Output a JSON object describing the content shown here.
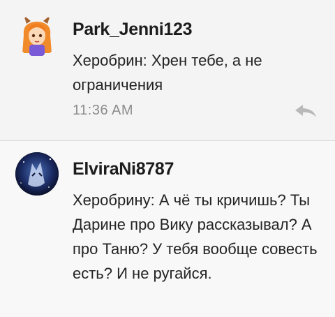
{
  "comments": [
    {
      "username": "Park_Jenni123",
      "text": "Херобрин: Хрен тебе, а не ограничения",
      "time": "11:36 AM",
      "avatar_icon": "cartoon-girl-avatar-icon",
      "reply_icon": "reply-arrow-icon"
    },
    {
      "username": "ElviraNi8787",
      "text": "Херобрину: А чё ты кричишь? Ты Дарине про Вику рассказывал? А про Таню? У тебя вообще совесть есть? И не ругайся.",
      "avatar_icon": "wolf-avatar-icon"
    }
  ],
  "colors": {
    "background": "#f4f4f4",
    "username": "#1c1c1c",
    "text": "#232323",
    "time": "#8c8c8c",
    "divider": "#d8d8d8"
  }
}
